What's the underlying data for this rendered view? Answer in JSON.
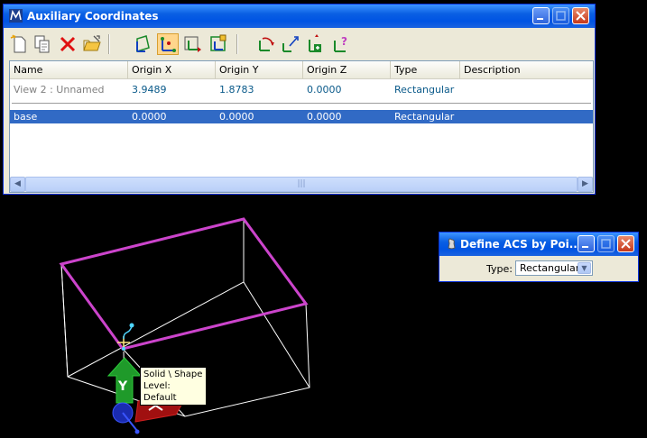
{
  "aux_window": {
    "title": "Auxiliary Coordinates",
    "toolbar_icons": [
      "new-acs-icon",
      "copy-acs-icon",
      "delete-icon",
      "open-folder-icon",
      "define-acs-by-element-icon",
      "define-acs-by-points-icon",
      "define-acs-by-view-icon",
      "define-acs-by-reference-icon",
      "rotate-acs-icon",
      "move-acs-icon",
      "select-acs-icon",
      "query-acs-icon"
    ],
    "columns": [
      "Name",
      "Origin X",
      "Origin Y",
      "Origin Z",
      "Type",
      "Description"
    ],
    "rows": [
      {
        "name": "View 2 : Unnamed",
        "x": "3.9489",
        "y": "1.8783",
        "z": "0.0000",
        "type": "Rectangular",
        "description": ""
      },
      {
        "name": "base",
        "x": "0.0000",
        "y": "0.0000",
        "z": "0.0000",
        "type": "Rectangular",
        "description": ""
      }
    ],
    "scroll_left": "◀",
    "scroll_right": "▶",
    "scroll_grip": "|||"
  },
  "define_window": {
    "title": "Define ACS by Poi...",
    "type_label": "Type:",
    "type_value": "Rectangular"
  },
  "tooltip": {
    "line1": "Solid \\ Shape",
    "line2": "Level: Default"
  },
  "triad": {
    "y_label": "Y"
  },
  "colors": {
    "highlight_shape": "#cc44cc",
    "wireframe": "#ffffff",
    "selection": "#316ac5"
  }
}
